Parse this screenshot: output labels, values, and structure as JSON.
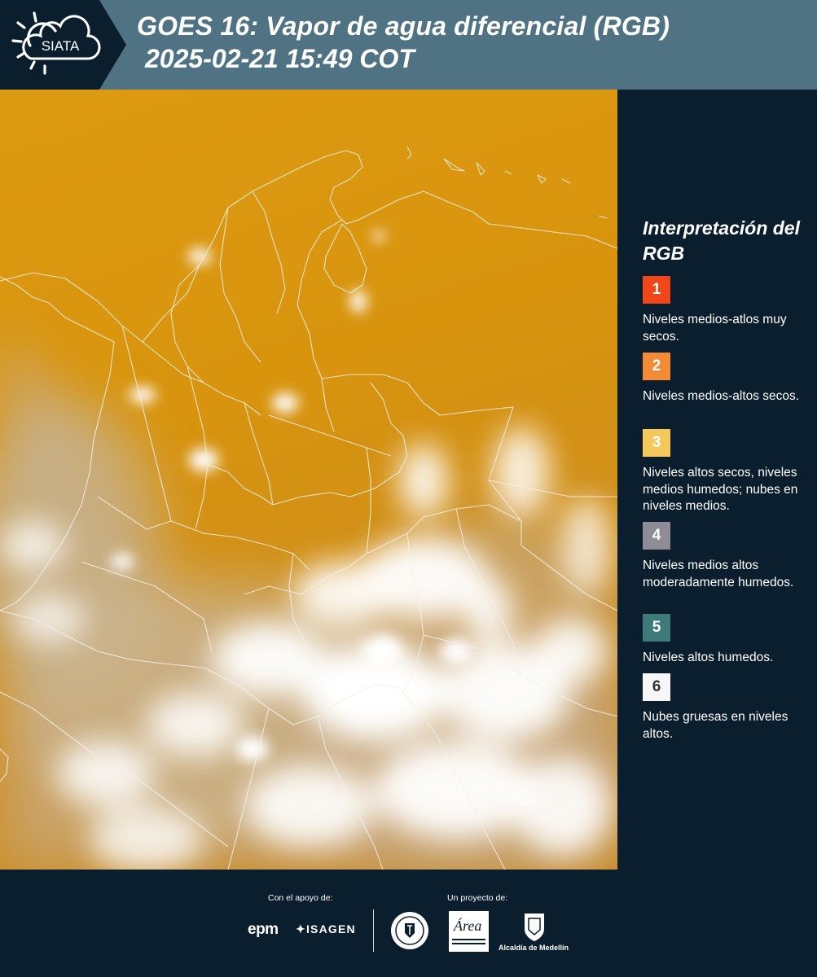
{
  "header": {
    "logo_text": "SIATA",
    "title_line1": "GOES 16: Vapor de agua diferencial (RGB)",
    "title_line2": "2025-02-21 15:49 COT",
    "background_color": "#4f7383"
  },
  "legend": {
    "title": "Interpretación del RGB",
    "items": [
      {
        "number": "1",
        "color": "#f0461a",
        "description": "Niveles medios-atlos muy secos."
      },
      {
        "number": "2",
        "color": "#f28a36",
        "description": "Niveles medios-altos secos."
      },
      {
        "number": "3",
        "color": "#f5c85c",
        "description": "Niveles altos secos, niveles medios humedos; nubes en niveles medios."
      },
      {
        "number": "4",
        "color": "#8f8c97",
        "description": "Niveles medios altos moderadamente humedos."
      },
      {
        "number": "5",
        "color": "#3f7a7b",
        "description": "Niveles altos humedos."
      },
      {
        "number": "6",
        "color": "#f7f7f7",
        "description": "Nubes gruesas en niveles altos."
      }
    ]
  },
  "footer": {
    "support_label": "Con el apoyo de:",
    "project_label": "Un proyecto de:",
    "epm_logo_text": "epm",
    "isagen_logo_text": "ISAGEN",
    "area_logo_text": "Área",
    "alcaldia_label": "Alcaldía de Medellín"
  },
  "map": {
    "dominant_color": "#d9960f",
    "cloud_color": "#ffffff"
  }
}
